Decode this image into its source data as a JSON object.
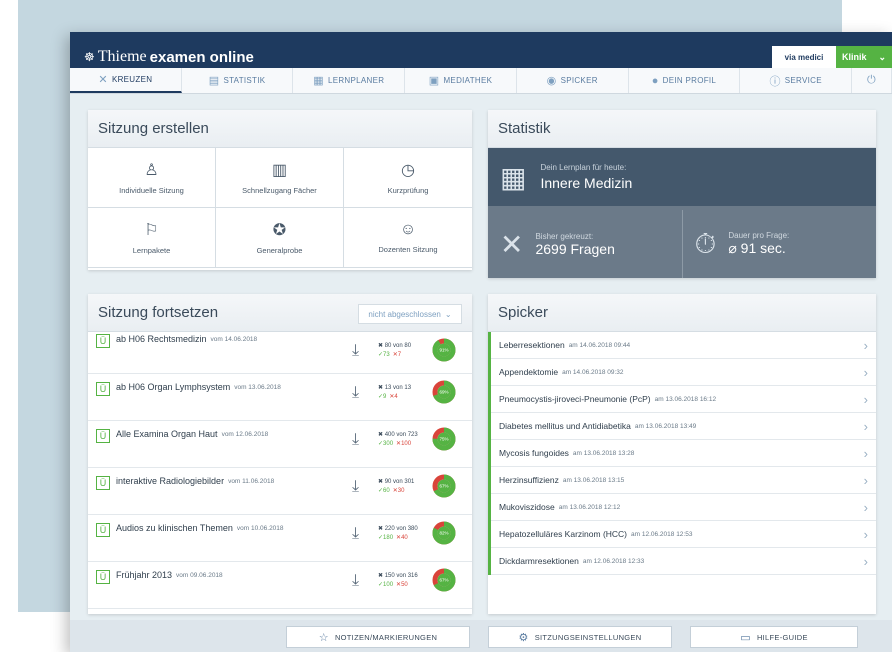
{
  "brand": {
    "part1": "Thieme",
    "part2": "examen online"
  },
  "toplinks": {
    "via": "via medici",
    "klinik": "Klinik"
  },
  "nav": [
    {
      "label": "KREUZEN",
      "icon": "✕"
    },
    {
      "label": "STATISTIK",
      "icon": "▤"
    },
    {
      "label": "LERNPLANER",
      "icon": "▦"
    },
    {
      "label": "MEDIATHEK",
      "icon": "▣"
    },
    {
      "label": "SPICKER",
      "icon": "◉"
    },
    {
      "label": "DEIN PROFIL",
      "icon": "●"
    },
    {
      "label": "SERVICE",
      "icon": "ⓘ"
    }
  ],
  "create": {
    "title": "Sitzung erstellen",
    "items": [
      {
        "label": "Individuelle Sitzung",
        "icon": "♙"
      },
      {
        "label": "Schnellzugang Fächer",
        "icon": "▥"
      },
      {
        "label": "Kurzprüfung",
        "icon": "◷"
      },
      {
        "label": "Lernpakete",
        "icon": "⚐"
      },
      {
        "label": "Generalprobe",
        "icon": "✪"
      },
      {
        "label": "Dozenten Sitzung",
        "icon": "☺"
      }
    ]
  },
  "stat": {
    "title": "Statistik",
    "plan_label": "Dein Lernplan für heute:",
    "plan_value": "Innere Medizin",
    "crossed_label": "Bisher gekreuzt:",
    "crossed_value": "2699 Fragen",
    "duration_label": "Dauer pro Frage:",
    "duration_value": "⌀  91 sec."
  },
  "cont": {
    "title": "Sitzung fortsetzen",
    "filter": "nicht abgeschlossen",
    "rows": [
      {
        "name": "ab H06 Rechtsmedizin",
        "date": "vom 14.06.2018",
        "count": "80 von 80",
        "ok": "✓73",
        "no": "✕7",
        "pct_label": "91%",
        "pct": 0.91
      },
      {
        "name": "ab H06 Organ Lymphsystem",
        "date": "vom 13.06.2018",
        "count": "13 von 13",
        "ok": "✓9",
        "no": "✕4",
        "pct_label": "69%",
        "pct": 0.69
      },
      {
        "name": "Alle Examina Organ Haut",
        "date": "vom 12.06.2018",
        "count": "400 von 723",
        "ok": "✓300",
        "no": "✕100",
        "pct_label": "75%",
        "pct": 0.75
      },
      {
        "name": "interaktive Radiologiebilder",
        "date": "vom 11.06.2018",
        "count": "90 von 301",
        "ok": "✓60",
        "no": "✕30",
        "pct_label": "67%",
        "pct": 0.67
      },
      {
        "name": "Audios zu klinischen Themen",
        "date": "vom 10.06.2018",
        "count": "220 von 380",
        "ok": "✓180",
        "no": "✕40",
        "pct_label": "82%",
        "pct": 0.82
      },
      {
        "name": "Frühjahr 2013",
        "date": "vom 09.06.2018",
        "count": "150 von 316",
        "ok": "✓100",
        "no": "✕50",
        "pct_label": "67%",
        "pct": 0.67
      }
    ]
  },
  "spick": {
    "title": "Spicker",
    "rows": [
      {
        "title": "Leberresektionen",
        "date": "am 14.06.2018 09:44"
      },
      {
        "title": "Appendektomie",
        "date": "am 14.06.2018 09:32"
      },
      {
        "title": "Pneumocystis-jiroveci-Pneumonie (PcP)",
        "date": "am 13.06.2018 16:12"
      },
      {
        "title": "Diabetes mellitus und Antidiabetika",
        "date": "am 13.06.2018 13:49"
      },
      {
        "title": "Mycosis fungoides",
        "date": "am 13.06.2018 13:28"
      },
      {
        "title": "Herzinsuffizienz",
        "date": "am 13.06.2018 13:15"
      },
      {
        "title": "Mukoviszidose",
        "date": "am 13.06.2018 12:12"
      },
      {
        "title": "Hepatozelluläres Karzinom (HCC)",
        "date": "am 12.06.2018 12:53"
      },
      {
        "title": "Dickdarmresektionen",
        "date": "am 12.06.2018 12:33"
      }
    ]
  },
  "bottom": {
    "notes": "NOTIZEN/MARKIERUNGEN",
    "settings": "SITZUNGSEINSTELLUNGEN",
    "help": "HILFE-GUIDE"
  },
  "colors": {
    "navy": "#1e3a5f",
    "green": "#55b343",
    "red": "#d9443a"
  }
}
